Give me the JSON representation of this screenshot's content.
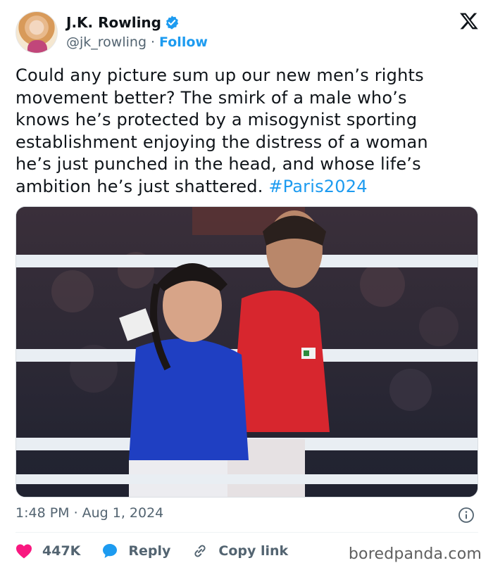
{
  "author": {
    "name": "J.K. Rowling",
    "handle": "@jk_rowling",
    "separator": "·",
    "follow_label": "Follow"
  },
  "tweet": {
    "text_lines": [
      "Could any picture sum up our new men’s rights",
      "movement better? The smirk of a male who’s",
      "knows he’s protected by a misogynist sporting",
      "establishment enjoying the distress of a woman",
      "he’s just punched in the head, and whose life’s",
      "ambition he’s just shattered. "
    ],
    "hashtag": "#Paris2024"
  },
  "meta": {
    "time": "1:48 PM",
    "separator": "·",
    "date": "Aug 1, 2024"
  },
  "actions": {
    "likes": "447K",
    "reply_label": "Reply",
    "copy_label": "Copy link"
  },
  "watermark": "boredpanda.com",
  "colors": {
    "accent": "#1d9bf0",
    "like": "#f91880",
    "secondary_text": "#536471"
  },
  "icons": [
    "verified-badge-icon",
    "x-logo-icon",
    "info-icon",
    "heart-icon",
    "reply-bubble-icon",
    "link-icon"
  ]
}
